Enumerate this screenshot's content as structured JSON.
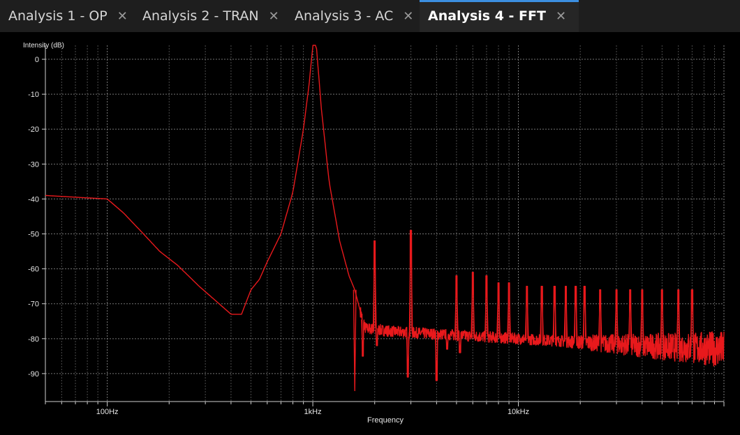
{
  "tabs": [
    {
      "label": "Analysis 1 - OP",
      "active": false
    },
    {
      "label": "Analysis 2 - TRAN",
      "active": false
    },
    {
      "label": "Analysis 3 - AC",
      "active": false
    },
    {
      "label": "Analysis 4 - FFT",
      "active": true
    }
  ],
  "colors": {
    "accent": "#3c8fe0",
    "trace": "#e8191c",
    "grid": "#8a8a8a",
    "background": "#000000"
  },
  "icons": {
    "close": "close-icon"
  },
  "chart_data": {
    "type": "line",
    "title": "",
    "xlabel": "Frequency",
    "ylabel": "Intensity (dB)",
    "xscale": "log",
    "xlim": [
      50,
      100000
    ],
    "ylim": [
      -98,
      4
    ],
    "xticks": [
      {
        "value": 100,
        "label": "100Hz"
      },
      {
        "value": 1000,
        "label": "1kHz"
      },
      {
        "value": 10000,
        "label": "10kHz"
      }
    ],
    "yticks": [
      0,
      -10,
      -20,
      -30,
      -40,
      -50,
      -60,
      -70,
      -80,
      -90
    ],
    "grid": true,
    "series": [
      {
        "name": "",
        "color": "#e8191c",
        "baseline": {
          "x": [
            50,
            100,
            120,
            150,
            180,
            220,
            280,
            350,
            400,
            450,
            500,
            550,
            600,
            700,
            800,
            900,
            960,
            1000,
            1040,
            1100,
            1200,
            1350,
            1500,
            1600,
            1700,
            1800,
            2500,
            5000,
            10000,
            20000,
            40000,
            100000
          ],
          "y": [
            -39,
            -40,
            -44,
            -50,
            -55,
            -59,
            -65,
            -70,
            -73,
            -73,
            -66,
            -63,
            -58,
            -50,
            -38,
            -20,
            -7,
            4,
            4,
            -14,
            -35,
            -52,
            -62,
            -66,
            -72,
            -77,
            -78,
            -79,
            -80,
            -81,
            -82,
            -83
          ]
        },
        "peaks": [
          {
            "x": 2000,
            "y": -52
          },
          {
            "x": 3000,
            "y": -49
          },
          {
            "x": 5000,
            "y": -62
          },
          {
            "x": 6000,
            "y": -61
          },
          {
            "x": 7000,
            "y": -62
          },
          {
            "x": 8000,
            "y": -64
          },
          {
            "x": 9000,
            "y": -64
          },
          {
            "x": 11000,
            "y": -65
          },
          {
            "x": 13000,
            "y": -65
          },
          {
            "x": 15000,
            "y": -65
          },
          {
            "x": 17000,
            "y": -65
          },
          {
            "x": 19000,
            "y": -65
          },
          {
            "x": 21000,
            "y": -65
          },
          {
            "x": 25000,
            "y": -66
          },
          {
            "x": 30000,
            "y": -66
          },
          {
            "x": 35000,
            "y": -66
          },
          {
            "x": 40000,
            "y": -66
          },
          {
            "x": 50000,
            "y": -66
          },
          {
            "x": 60000,
            "y": -66
          },
          {
            "x": 70000,
            "y": -66
          }
        ],
        "dips": [
          {
            "x": 1600,
            "y": -95
          },
          {
            "x": 1750,
            "y": -85
          },
          {
            "x": 2050,
            "y": -82
          },
          {
            "x": 2900,
            "y": -91
          },
          {
            "x": 4000,
            "y": -92
          },
          {
            "x": 4500,
            "y": -83
          },
          {
            "x": 5200,
            "y": -84
          }
        ]
      }
    ]
  }
}
